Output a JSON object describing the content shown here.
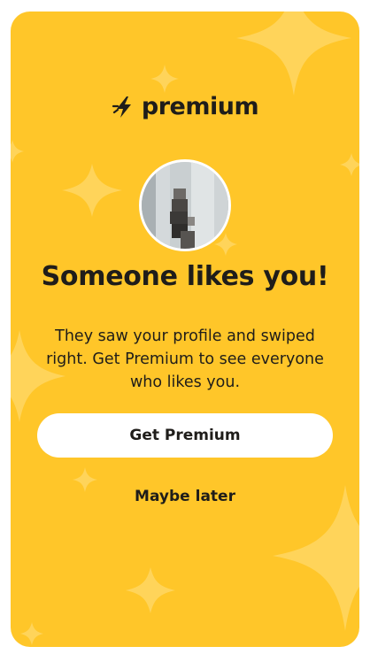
{
  "brand": {
    "icon": "lightning-bolt-icon",
    "name": "premium"
  },
  "avatar": {
    "description": "blurred-profile-photo"
  },
  "headline": "Someone likes you!",
  "body": "They saw your profile and swiped right. Get Premium to see everyone who likes you.",
  "actions": {
    "primary_label": "Get Premium",
    "secondary_label": "Maybe later"
  },
  "colors": {
    "background": "#ffc629",
    "text": "#1f1d1a",
    "button": "#ffffff",
    "sparkle": "#ffd86a"
  }
}
